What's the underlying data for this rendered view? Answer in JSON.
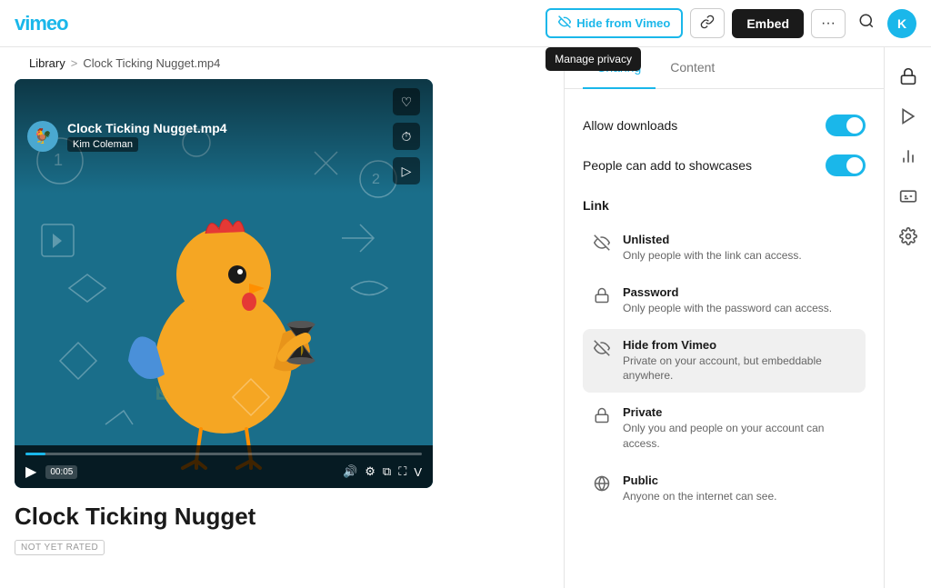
{
  "nav": {
    "logo": "vimeo",
    "hide_from_vimeo_label": "Hide from Vimeo",
    "link_icon": "🔗",
    "embed_label": "Embed",
    "more_icon": "···",
    "search_icon": "🔍",
    "avatar_initials": "K"
  },
  "tooltip": {
    "text": "Manage privacy"
  },
  "breadcrumb": {
    "library": "Library",
    "separator": ">",
    "current": "Clock Ticking Nugget.mp4"
  },
  "video": {
    "title": "Clock Ticking Nugget.mp4",
    "user": "Kim Coleman",
    "time": "00:05",
    "main_title": "Clock Ticking Nugget",
    "rating": "NOT YET RATED"
  },
  "panel": {
    "tabs": [
      {
        "id": "sharing",
        "label": "Sharing",
        "active": false
      },
      {
        "id": "content",
        "label": "Content",
        "active": false
      }
    ],
    "sharing": {
      "allow_downloads_label": "Allow downloads",
      "add_showcases_label": "People can add to showcases",
      "link_section_title": "Link",
      "options": [
        {
          "id": "unlisted",
          "icon": "👁",
          "title": "Unlisted",
          "desc": "Only people with the link can access.",
          "selected": false
        },
        {
          "id": "password",
          "icon": "🔒",
          "title": "Password",
          "desc": "Only people with the password can access.",
          "selected": false
        },
        {
          "id": "hide_from_vimeo",
          "icon": "👁",
          "title": "Hide from Vimeo",
          "desc": "Private on your account, but embeddable anywhere.",
          "selected": true
        },
        {
          "id": "private",
          "icon": "🔒",
          "title": "Private",
          "desc": "Only you and people on your account can access.",
          "selected": false
        },
        {
          "id": "public",
          "icon": "🌐",
          "title": "Public",
          "desc": "Anyone on the internet can see.",
          "selected": false
        }
      ]
    }
  },
  "right_sidebar": {
    "icons": [
      "lock",
      "play",
      "chart",
      "cc",
      "gear"
    ]
  }
}
